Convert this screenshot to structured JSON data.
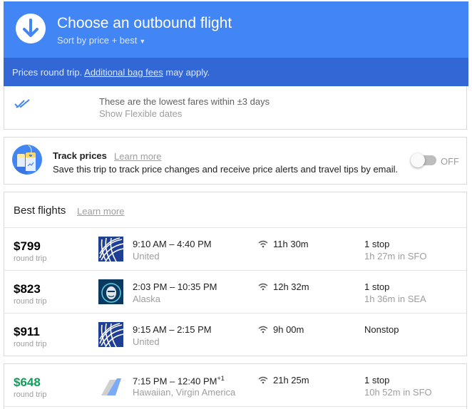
{
  "header": {
    "title": "Choose an outbound flight",
    "sort_label": "Sort by price + best",
    "bg_color": "#4285f4"
  },
  "subheader": {
    "prefix": "Prices round trip. ",
    "link": "Additional bag fees",
    "suffix": " may apply."
  },
  "flexible": {
    "line1": "These are the lowest fares within ±3 days",
    "link": "Show Flexible dates"
  },
  "track": {
    "title": "Track prices",
    "learn_more": "Learn more",
    "description": "Save this trip to track price changes and receive price alerts and travel tips by email.",
    "toggle_state": "OFF"
  },
  "best": {
    "title": "Best flights",
    "learn_more": "Learn more",
    "flights": [
      {
        "price": "$799",
        "price_note": "round trip",
        "logo": "united",
        "times": "9:10 AM – 4:40 PM",
        "airline": "United",
        "duration": "11h 30m",
        "stops": "1 stop",
        "layover": "1h 27m in SFO"
      },
      {
        "price": "$823",
        "price_note": "round trip",
        "logo": "alaska",
        "times": "2:03 PM – 10:35 PM",
        "airline": "Alaska",
        "duration": "12h 32m",
        "stops": "1 stop",
        "layover": "1h 36m in SEA"
      },
      {
        "price": "$911",
        "price_note": "round trip",
        "logo": "united",
        "times": "9:15 AM – 2:15 PM",
        "airline": "United",
        "duration": "9h 00m",
        "stops": "Nonstop",
        "layover": ""
      }
    ]
  },
  "other": {
    "flights": [
      {
        "price": "$648",
        "price_note": "round trip",
        "logo": "multi-airline",
        "times": "7:15 PM – 12:40 PM",
        "day_offset": "+1",
        "airline": "Hawaiian, Virgin America",
        "duration": "21h 25m",
        "stops": "1 stop",
        "layover": "10h 52m in SFO",
        "price_color": "#0f9d58"
      }
    ]
  }
}
